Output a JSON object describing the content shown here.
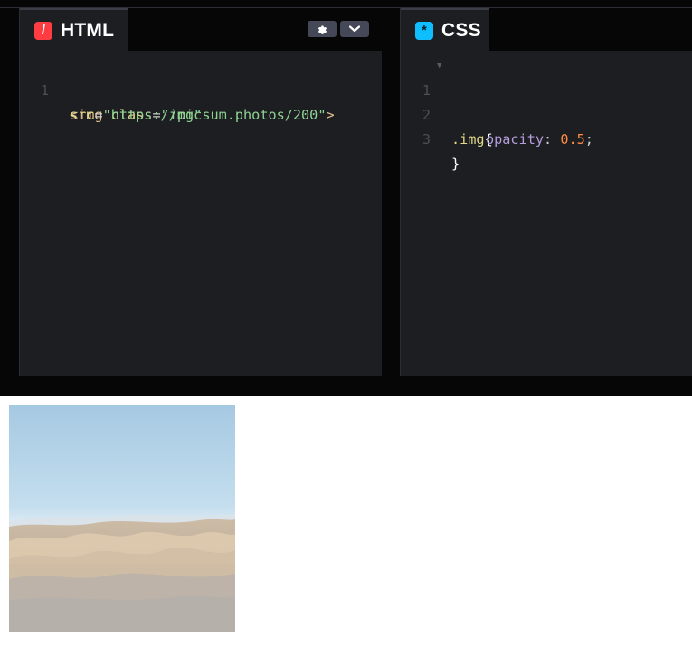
{
  "html_pane": {
    "title": "HTML",
    "icon": "slash-icon",
    "icon_glyph": "/",
    "color": "#ff3c41",
    "lines": [
      {
        "number": "1",
        "tag_open": "<img",
        "space": " ",
        "attr1": "class",
        "eq1": "=",
        "val1": "\"img\"",
        "wrap_attr": "src",
        "wrap_eq": "=",
        "wrap_val": "\"https://picsum.photos/200\"",
        "tag_close": ">"
      }
    ]
  },
  "css_pane": {
    "title": "CSS",
    "icon": "asterisk-icon",
    "icon_glyph": "*",
    "color": "#0ebeff",
    "lines": [
      {
        "number": "1",
        "selector": ".img",
        "brace": "{"
      },
      {
        "number": "2",
        "property": "opacity",
        "colon": ":",
        "value": "0.5",
        "semi": ";"
      },
      {
        "number": "3",
        "brace": "}"
      }
    ]
  },
  "preview": {
    "image_opacity": 0.5
  }
}
